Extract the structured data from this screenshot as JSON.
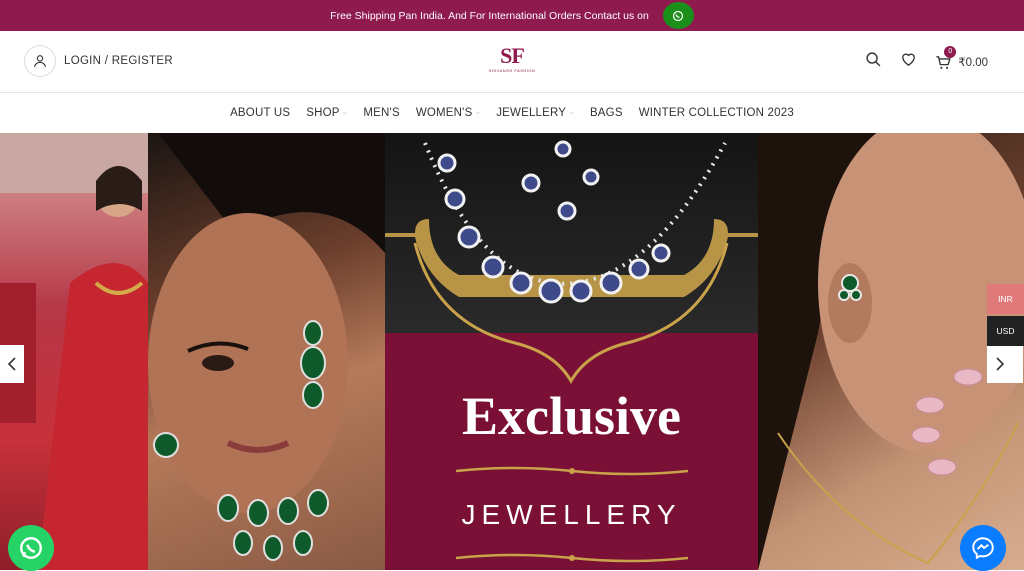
{
  "topbar": {
    "text": "Free Shipping Pan India. And For International Orders Contact us on"
  },
  "header": {
    "login_label": "LOGIN / REGISTER",
    "logo_text": "SF",
    "logo_subtext": "SHIVANSH FASHION",
    "cart_count": "0",
    "cart_total": "₹0.00"
  },
  "nav": {
    "items": [
      {
        "label": "ABOUT US",
        "dropdown": false
      },
      {
        "label": "SHOP",
        "dropdown": true
      },
      {
        "label": "MEN'S",
        "dropdown": false
      },
      {
        "label": "WOMEN'S",
        "dropdown": true
      },
      {
        "label": "JEWELLERY",
        "dropdown": true
      },
      {
        "label": "BAGS",
        "dropdown": false
      },
      {
        "label": "WINTER COLLECTION 2023",
        "dropdown": false
      }
    ]
  },
  "hero": {
    "headline": "Exclusive",
    "subheadline": "JEWELLERY"
  },
  "currency": {
    "options": [
      "INR",
      "USD"
    ],
    "active": "INR"
  },
  "colors": {
    "brand": "#8e1a4e",
    "whatsapp": "#25d366",
    "messenger": "#0a7cff",
    "accent_gold": "#c9a24a"
  },
  "icons": [
    "whatsapp-icon",
    "user-icon",
    "search-icon",
    "heart-icon",
    "cart-icon",
    "chevron-left-icon",
    "chevron-right-icon",
    "messenger-icon"
  ]
}
